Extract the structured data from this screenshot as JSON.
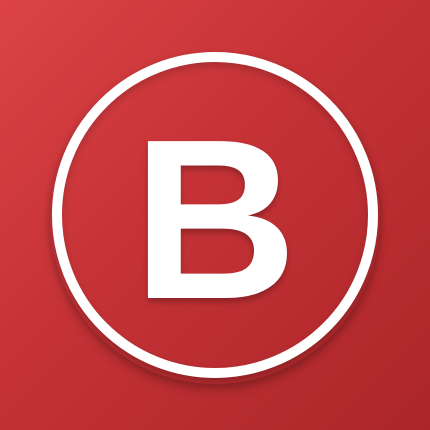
{
  "logo": {
    "letter": "B",
    "background_color": "#c43236",
    "foreground_color": "#ffffff",
    "icon": "letter-b-in-circle-icon"
  }
}
